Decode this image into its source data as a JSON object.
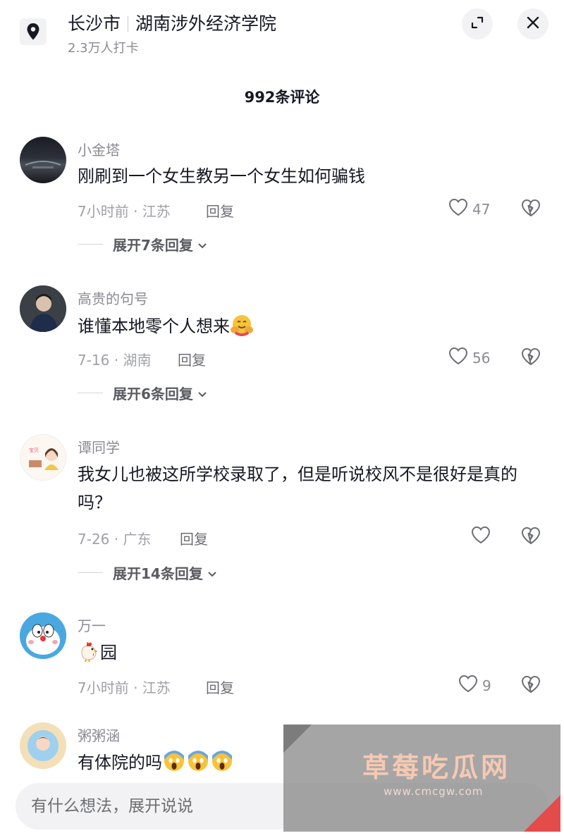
{
  "header": {
    "city": "长沙市",
    "place": "湖南涉外经济学院",
    "checkins": "2.3万人打卡"
  },
  "comments_header": {
    "count_label": "992条评论"
  },
  "comments": [
    {
      "name": "小金塔",
      "text": "刚刷到一个女生教另一个女生如何骗钱",
      "meta": "7小时前 · 江苏",
      "reply": "回复",
      "likes": "47",
      "expand": "展开7条回复"
    },
    {
      "name": "高贵的句号",
      "text": "谁懂本地零个人想来",
      "meta": "7-16 · 湖南",
      "reply": "回复",
      "likes": "56",
      "expand": "展开6条回复"
    },
    {
      "name": "谭同学",
      "text": "我女儿也被这所学校录取了，但是听说校风不是很好是真的吗？",
      "meta": "7-26 · 广东",
      "reply": "回复",
      "likes": "",
      "expand": "展开14条回复"
    },
    {
      "name": "万一",
      "text": "园",
      "meta": "7小时前 · 江苏",
      "reply": "回复",
      "likes": "9",
      "expand": ""
    },
    {
      "name": "粥粥涵",
      "text": "有体院的吗",
      "meta": "",
      "reply": "",
      "likes": "",
      "expand": ""
    }
  ],
  "input": {
    "placeholder": "有什么想法，展开说说"
  },
  "watermark": {
    "title": "草莓吃瓜网",
    "url": "www.cmcgw.com"
  },
  "colors": {
    "text": "#161823",
    "muted": "#8a8b91",
    "bg_button": "#f2f2f4"
  },
  "icons": [
    "location-pin-icon",
    "expand-icon",
    "close-icon",
    "heart-icon",
    "broken-heart-icon",
    "chevron-down-icon",
    "hugging-face-emoji",
    "chicken-emoji",
    "scream-face-emoji"
  ]
}
